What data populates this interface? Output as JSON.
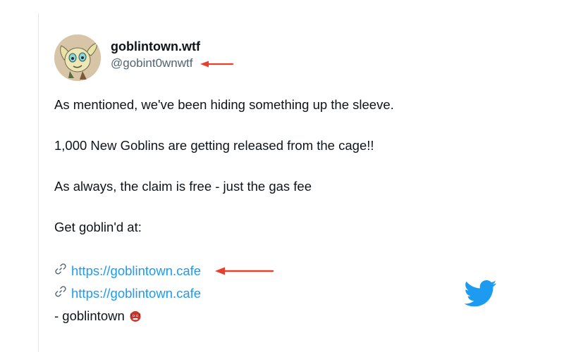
{
  "author": {
    "display_name": "goblintown.wtf",
    "handle": "@gobint0wnwtf"
  },
  "tweet": {
    "line1": "As mentioned, we've been hiding something up the sleeve.",
    "line2": "1,000 New Goblins are getting released from the cage!!",
    "line3": "As always, the claim is free - just the gas fee",
    "line4": "Get goblin'd at:",
    "links": [
      {
        "icon": "link-icon",
        "text": "https://goblintown.cafe"
      },
      {
        "icon": "link-icon",
        "text": "https://goblintown.cafe"
      }
    ],
    "signature": "- goblintown"
  },
  "colors": {
    "accent": "#1d9bf0",
    "annotation_arrow": "#e8402c",
    "text": "#0f1419",
    "muted": "#536471"
  },
  "icons": {
    "avatar": "goblin-avatar",
    "logo": "twitter-bird-icon",
    "emoji": "goblin-face-emoji"
  }
}
